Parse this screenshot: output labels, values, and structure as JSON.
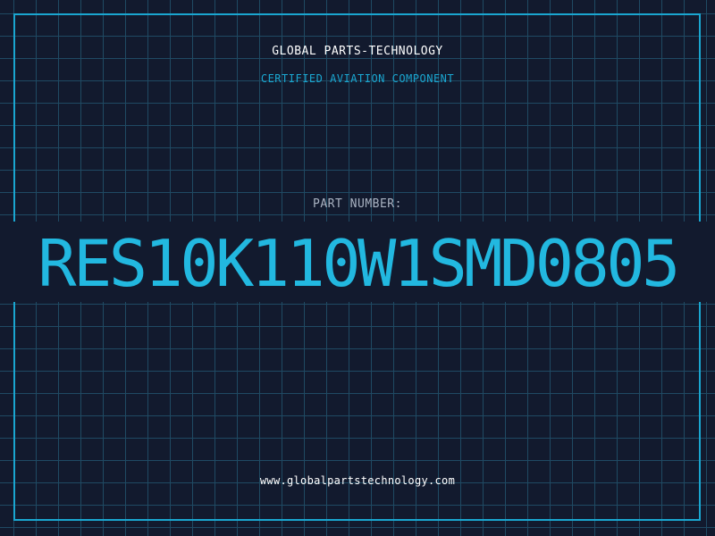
{
  "header": {
    "company": "GLOBAL PARTS-TECHNOLOGY",
    "subtitle": "CERTIFIED AVIATION COMPONENT"
  },
  "part": {
    "label": "PART NUMBER:",
    "number": "RES10K110W1SMD0805"
  },
  "footer": {
    "website": "www.globalpartstechnology.com"
  },
  "colors": {
    "background": "#121a2e",
    "grid": "#1f4a63",
    "accent": "#22b8e0",
    "frame": "#1aa6d0",
    "text": "#ffffff",
    "label": "#aab3c2"
  }
}
